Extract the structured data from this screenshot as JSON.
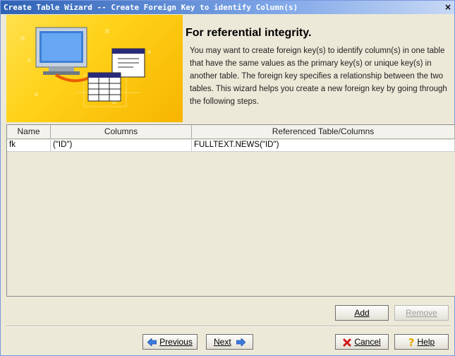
{
  "window": {
    "title": "Create Table Wizard -- Create Foreign Key to identify Column(s)"
  },
  "header": {
    "heading": "For referential integrity.",
    "description": "You may want to create foreign key(s) to identify column(s) in one table that have the same values as the primary key(s) or unique key(s) in another table. The foreign key specifies a relationship between the two tables. This wizard helps you create a new foreign key by going through the following steps."
  },
  "table": {
    "columns": [
      "Name",
      "Columns",
      "Referenced Table/Columns"
    ],
    "rows": [
      {
        "name": "fk",
        "columns": "(\"ID\")",
        "referenced": "FULLTEXT.NEWS(\"ID\")"
      }
    ]
  },
  "buttons": {
    "add": "Add",
    "remove": "Remove",
    "previous": "Previous",
    "next": "Next",
    "cancel": "Cancel",
    "help": "Help"
  },
  "icons": {
    "previous": "arrow-left-icon",
    "next": "arrow-right-icon",
    "cancel": "red-x-icon",
    "help": "question-mark-icon"
  }
}
